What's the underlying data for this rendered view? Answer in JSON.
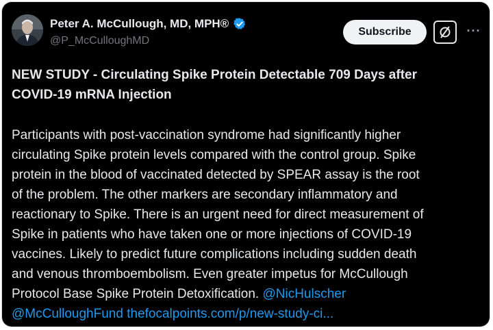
{
  "post": {
    "author": {
      "display_name": "Peter A. McCullough, MD, MPH®",
      "handle": "@P_McCulloughMD",
      "verified": true,
      "verified_color": "#1d9bf0",
      "avatar_icon": "profile-photo"
    },
    "actions": {
      "subscribe_label": "Subscribe",
      "grok_icon": "slashed-square-icon",
      "more_icon": "more-icon",
      "more_glyph": "···"
    },
    "headline_lines": [
      "NEW STUDY - Circulating Spike Protein Detectable 709 Days after",
      "COVID-19 mRNA Injection"
    ],
    "body_lines": [
      "Participants with post-vaccination syndrome had significantly higher",
      "circulating Spike protein levels compared with the control group.  Spike",
      "protein in the blood of vaccinated detected by SPEAR assay is the root",
      "of the problem.  The other markers are secondary inflammatory and",
      "reactionary to Spike.  There is an urgent need for direct measurement of",
      "Spike in patients who have taken one or more injections of COVID-19",
      "vaccines.  Likely to predict future complications including sudden death",
      "and venous thromboembolism.  Even greater impetus for McCullough",
      "Protocol Base Spike Protein Detoxification.    "
    ],
    "mention_1": "@NicHulscher",
    "mention_2": "@McCulloughFund",
    "link_text": "thefocalpoints.com/p/new-study-ci...",
    "colors": {
      "background": "#000000",
      "text": "#e7e9ea",
      "secondary_text": "#71767b",
      "link": "#1d9bf0",
      "button_bg": "#eff3f4"
    }
  }
}
